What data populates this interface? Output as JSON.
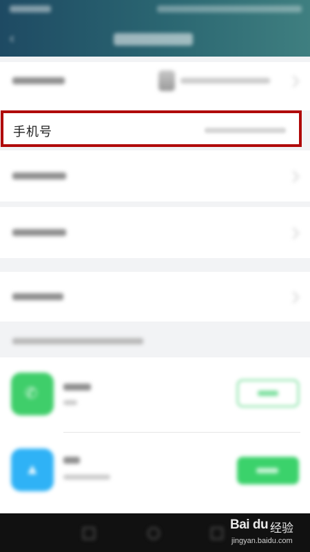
{
  "screen": {
    "title": "",
    "highlight_color": "#b00a0a",
    "header_gradient": [
      "#1e4a63",
      "#3f7f80"
    ]
  },
  "rows": {
    "phone_label": "手机号"
  },
  "icons": {
    "back": "back-arrow-icon",
    "phone_app": "phone-icon",
    "blue_app": "app-icon"
  },
  "apps": {
    "green_color": "#3fce6a",
    "blue_color": "#2fb2f6",
    "button_color": "#3bd26b"
  },
  "watermark": {
    "brand": "Bai du",
    "label": "经验",
    "url": "jingyan.baidu.com"
  }
}
